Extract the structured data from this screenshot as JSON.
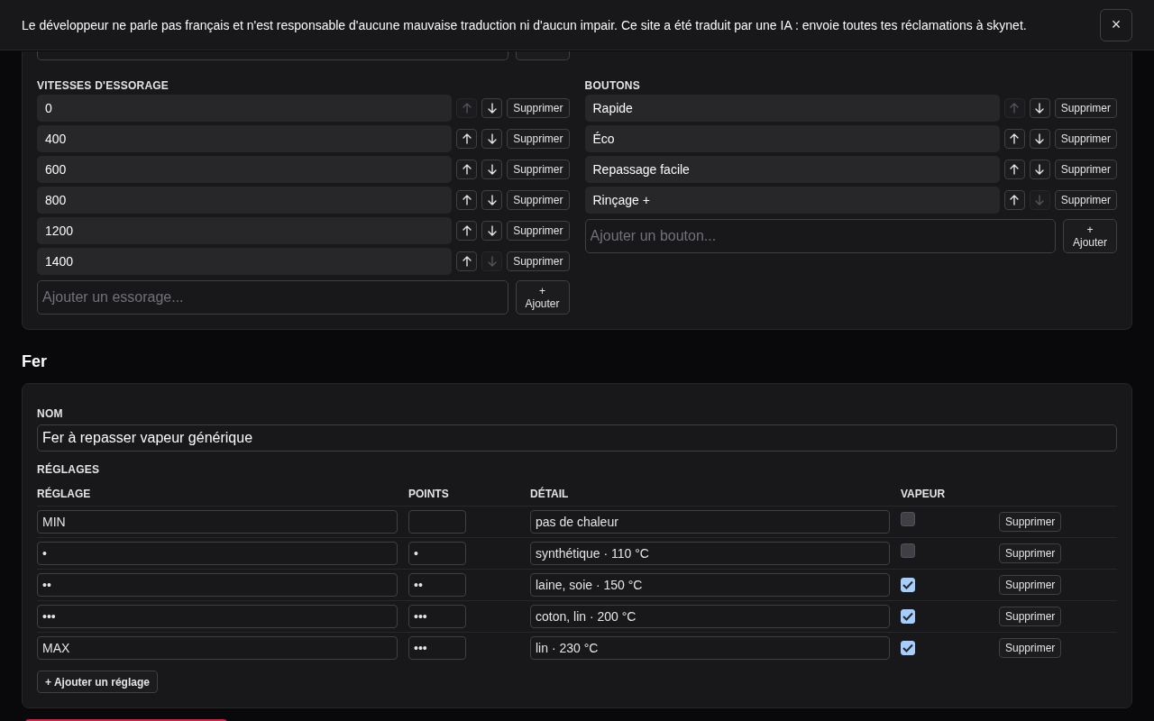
{
  "banner": {
    "message": "Le développeur ne parle pas français et n'est responsable d'aucune mauvaise traduction ni d'aucun impair. Ce site a été traduit par une IA : envoie toutes tes réclamations à skynet.",
    "close": "×"
  },
  "spin": {
    "label": "VITESSES D'ESSORAGE",
    "items": [
      {
        "value": "0",
        "up_disabled": true,
        "down_disabled": false,
        "remove": "Supprimer"
      },
      {
        "value": "400",
        "up_disabled": false,
        "down_disabled": false,
        "remove": "Supprimer"
      },
      {
        "value": "600",
        "up_disabled": false,
        "down_disabled": false,
        "remove": "Supprimer"
      },
      {
        "value": "800",
        "up_disabled": false,
        "down_disabled": false,
        "remove": "Supprimer"
      },
      {
        "value": "1200",
        "up_disabled": false,
        "down_disabled": false,
        "remove": "Supprimer"
      },
      {
        "value": "1400",
        "up_disabled": false,
        "down_disabled": true,
        "remove": "Supprimer"
      }
    ],
    "add_placeholder": "Ajouter un essorage...",
    "add_button": [
      "+",
      "Ajouter"
    ]
  },
  "buttons": {
    "label": "BOUTONS",
    "items": [
      {
        "value": "Rapide",
        "up_disabled": true,
        "down_disabled": false,
        "remove": "Supprimer"
      },
      {
        "value": "Éco",
        "up_disabled": false,
        "down_disabled": false,
        "remove": "Supprimer"
      },
      {
        "value": "Repassage facile",
        "up_disabled": false,
        "down_disabled": false,
        "remove": "Supprimer"
      },
      {
        "value": "Rinçage +",
        "up_disabled": false,
        "down_disabled": true,
        "remove": "Supprimer"
      }
    ],
    "add_placeholder": "Ajouter un bouton...",
    "add_button": [
      "+",
      "Ajouter"
    ]
  },
  "iron": {
    "heading": "Fer",
    "name_label": "NOM",
    "name": "Fer à repasser vapeur générique",
    "settings_label": "RÉGLAGES",
    "columns": [
      "RÉGLAGE",
      "POINTS",
      "DÉTAIL",
      "VAPEUR"
    ],
    "rows": [
      {
        "setting": "MIN",
        "detail": "pas de chaleur",
        "steam": false,
        "remove": "Supprimer"
      },
      {
        "setting": "•",
        "points": "•",
        "detail": "synthétique · 110 °C",
        "steam": false,
        "remove": "Supprimer"
      },
      {
        "setting": "••",
        "points": "••",
        "detail": "laine, soie · 150 °C",
        "steam": true,
        "remove": "Supprimer"
      },
      {
        "setting": "•••",
        "points": "•••",
        "detail": "coton, lin · 200 °C",
        "steam": true,
        "remove": "Supprimer"
      },
      {
        "setting": "MAX",
        "points": "•••",
        "detail": "lin · 230 °C",
        "steam": true,
        "remove": "Supprimer"
      }
    ],
    "add_button": "+ Ajouter un réglage"
  }
}
